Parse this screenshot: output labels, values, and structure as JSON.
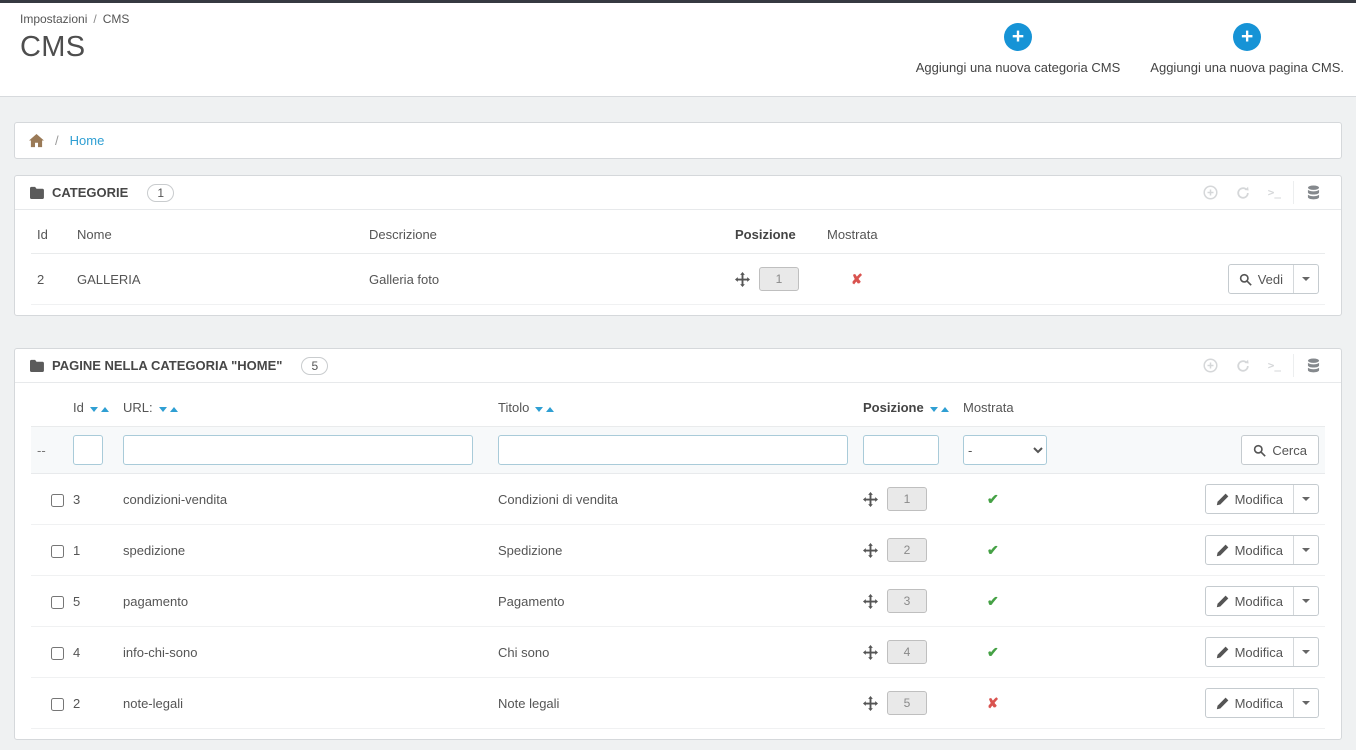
{
  "colors": {
    "accent": "#2f9fd3",
    "action-blue": "#1693d6",
    "success": "#45a145",
    "danger": "#d9534f"
  },
  "glyphs": {
    "plus": "+",
    "terminal": ">_"
  },
  "status_glyphs": {
    "shown": "✔",
    "hidden": "✘"
  },
  "header": {
    "breadcrumb": {
      "parent": "Impostazioni",
      "separator": "/",
      "current": "CMS"
    },
    "title": "CMS",
    "actions": [
      {
        "label": "Aggiungi una nuova categoria CMS"
      },
      {
        "label": "Aggiungi una nuova pagina CMS."
      }
    ]
  },
  "nav": {
    "separator": "/",
    "home": "Home"
  },
  "categories": {
    "title": "CATEGORIE",
    "count": "1",
    "headers": {
      "id": "Id",
      "name": "Nome",
      "description": "Descrizione",
      "position": "Posizione",
      "shown": "Mostrata"
    },
    "action_label": "Vedi",
    "rows": [
      {
        "id": "2",
        "name": "GALLERIA",
        "description": "Galleria foto",
        "position": "1",
        "shown": false
      }
    ]
  },
  "pages": {
    "title": "PAGINE NELLA CATEGORIA \"HOME\"",
    "count": "5",
    "headers": {
      "id": "Id",
      "url": "URL:",
      "title": "Titolo",
      "position": "Posizione",
      "shown": "Mostrata"
    },
    "filter": {
      "dash": "--",
      "select_value": "-",
      "search_label": "Cerca"
    },
    "action_label": "Modifica",
    "rows": [
      {
        "id": "3",
        "url": "condizioni-vendita",
        "title": "Condizioni di vendita",
        "position": "1",
        "shown": true
      },
      {
        "id": "1",
        "url": "spedizione",
        "title": "Spedizione",
        "position": "2",
        "shown": true
      },
      {
        "id": "5",
        "url": "pagamento",
        "title": "Pagamento",
        "position": "3",
        "shown": true
      },
      {
        "id": "4",
        "url": "info-chi-sono",
        "title": "Chi sono",
        "position": "4",
        "shown": true
      },
      {
        "id": "2",
        "url": "note-legali",
        "title": "Note legali",
        "position": "5",
        "shown": false
      }
    ]
  }
}
